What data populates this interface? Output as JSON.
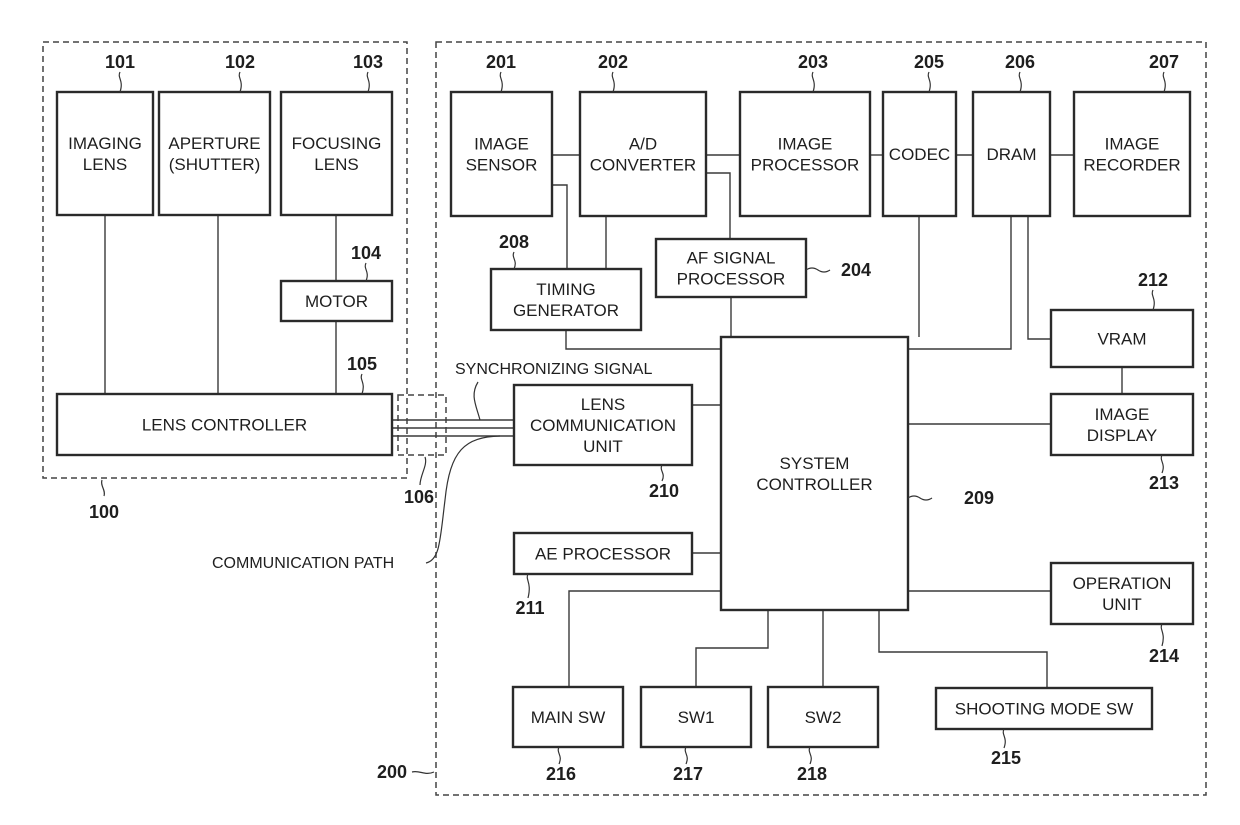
{
  "diagram": {
    "type": "block-diagram",
    "groups": {
      "lens_unit": {
        "ref": "100"
      },
      "camera_body": {
        "ref": "200"
      },
      "connector": {
        "ref": "106"
      }
    },
    "blocks": {
      "imaging_lens": {
        "ref": "101",
        "lines": [
          "IMAGING",
          "LENS"
        ]
      },
      "aperture": {
        "ref": "102",
        "lines": [
          "APERTURE",
          "(SHUTTER)"
        ]
      },
      "focusing_lens": {
        "ref": "103",
        "lines": [
          "FOCUSING",
          "LENS"
        ]
      },
      "motor": {
        "ref": "104",
        "lines": [
          "MOTOR"
        ]
      },
      "lens_controller": {
        "ref": "105",
        "lines": [
          "LENS CONTROLLER"
        ]
      },
      "image_sensor": {
        "ref": "201",
        "lines": [
          "IMAGE",
          "SENSOR"
        ]
      },
      "ad_converter": {
        "ref": "202",
        "lines": [
          "A/D",
          "CONVERTER"
        ]
      },
      "image_processor": {
        "ref": "203",
        "lines": [
          "IMAGE",
          "PROCESSOR"
        ]
      },
      "af_signal_processor": {
        "ref": "204",
        "lines": [
          "AF SIGNAL",
          "PROCESSOR"
        ]
      },
      "codec": {
        "ref": "205",
        "lines": [
          "CODEC"
        ]
      },
      "dram": {
        "ref": "206",
        "lines": [
          "DRAM"
        ]
      },
      "image_recorder": {
        "ref": "207",
        "lines": [
          "IMAGE",
          "RECORDER"
        ]
      },
      "timing_generator": {
        "ref": "208",
        "lines": [
          "TIMING",
          "GENERATOR"
        ]
      },
      "system_controller": {
        "ref": "209",
        "lines": [
          "SYSTEM",
          "CONTROLLER"
        ]
      },
      "lens_communication_unit": {
        "ref": "210",
        "lines": [
          "LENS",
          "COMMUNICATION",
          "UNIT"
        ]
      },
      "ae_processor": {
        "ref": "211",
        "lines": [
          "AE PROCESSOR"
        ]
      },
      "vram": {
        "ref": "212",
        "lines": [
          "VRAM"
        ]
      },
      "image_display": {
        "ref": "213",
        "lines": [
          "IMAGE",
          "DISPLAY"
        ]
      },
      "operation_unit": {
        "ref": "214",
        "lines": [
          "OPERATION",
          "UNIT"
        ]
      },
      "shooting_mode_sw": {
        "ref": "215",
        "lines": [
          "SHOOTING MODE SW"
        ]
      },
      "main_sw": {
        "ref": "216",
        "lines": [
          "MAIN SW"
        ]
      },
      "sw1": {
        "ref": "217",
        "lines": [
          "SW1"
        ]
      },
      "sw2": {
        "ref": "218",
        "lines": [
          "SW2"
        ]
      }
    },
    "annotations": {
      "synchronizing_signal": "SYNCHRONIZING SIGNAL",
      "communication_path": "COMMUNICATION PATH"
    }
  }
}
